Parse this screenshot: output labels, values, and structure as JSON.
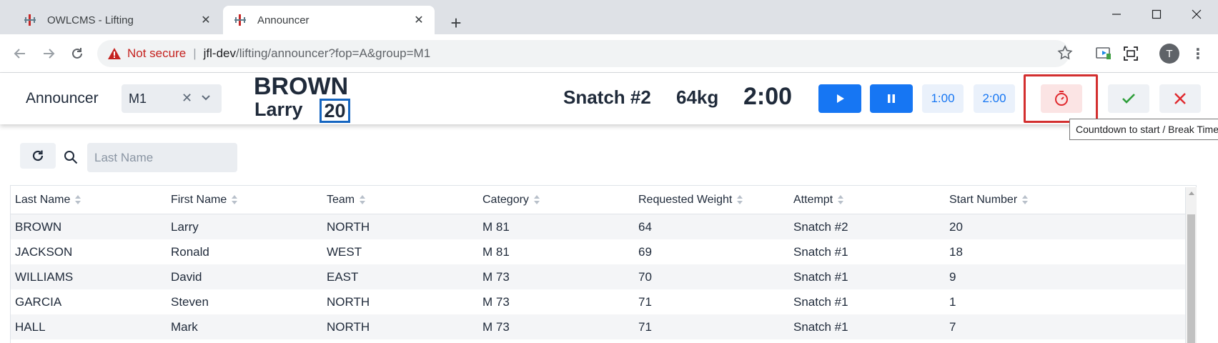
{
  "browser": {
    "tabs": [
      {
        "title": "OWLCMS - Lifting",
        "active": false
      },
      {
        "title": "Announcer",
        "active": true
      }
    ],
    "address": {
      "security_label": "Not secure",
      "host": "jfl-dev",
      "path": "/lifting/announcer?fop=A&group=M1"
    },
    "profile_initial": "T"
  },
  "header": {
    "title": "Announcer",
    "group_select": {
      "value": "M1"
    },
    "current_athlete": {
      "last_name": "BROWN",
      "first_name": "Larry",
      "start_number": "20"
    },
    "attempt": "Snatch #2",
    "weight": "64kg",
    "clock": "2:00",
    "buttons": {
      "time_1min": "1:00",
      "time_2min": "2:00"
    },
    "tooltip": "Countdown to start / Break Timer",
    "colors": {
      "primary": "#1676f3",
      "danger": "#e0292e",
      "success": "#2e9e3a",
      "highlight": "#d32f2f"
    }
  },
  "grid": {
    "search_placeholder": "Last Name",
    "columns": [
      "Last Name",
      "First Name",
      "Team",
      "Category",
      "Requested Weight",
      "Attempt",
      "Start Number"
    ],
    "rows": [
      [
        "BROWN",
        "Larry",
        "NORTH",
        "M 81",
        "64",
        "Snatch #2",
        "20"
      ],
      [
        "JACKSON",
        "Ronald",
        "WEST",
        "M 81",
        "69",
        "Snatch #1",
        "18"
      ],
      [
        "WILLIAMS",
        "David",
        "EAST",
        "M 73",
        "70",
        "Snatch #1",
        "9"
      ],
      [
        "GARCIA",
        "Steven",
        "NORTH",
        "M 73",
        "71",
        "Snatch #1",
        "1"
      ],
      [
        "HALL",
        "Mark",
        "NORTH",
        "M 73",
        "71",
        "Snatch #1",
        "7"
      ]
    ]
  }
}
